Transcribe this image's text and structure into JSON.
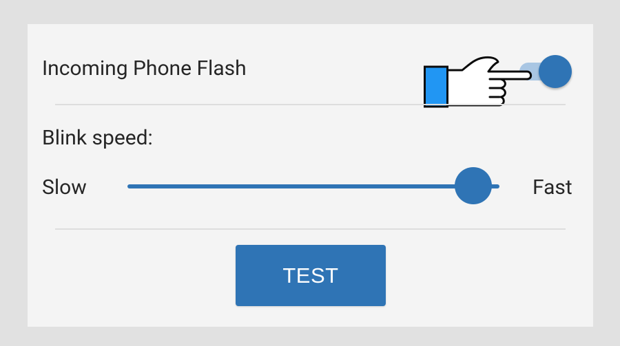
{
  "settings": {
    "flash_label": "Incoming Phone Flash",
    "flash_enabled": true,
    "blink_speed_label": "Blink speed:",
    "slider": {
      "min_label": "Slow",
      "max_label": "Fast",
      "value": 0.93
    },
    "test_button_label": "TEST"
  },
  "overlay": {
    "pointer_icon": "pointing-hand-icon",
    "pointer_cuff_color": "#2196f3"
  },
  "colors": {
    "accent": "#2f74b5",
    "track_off_tint": "#a9c6e3",
    "panel_bg": "#f4f4f4",
    "page_bg": "#e1e1e1",
    "text": "#262626"
  }
}
